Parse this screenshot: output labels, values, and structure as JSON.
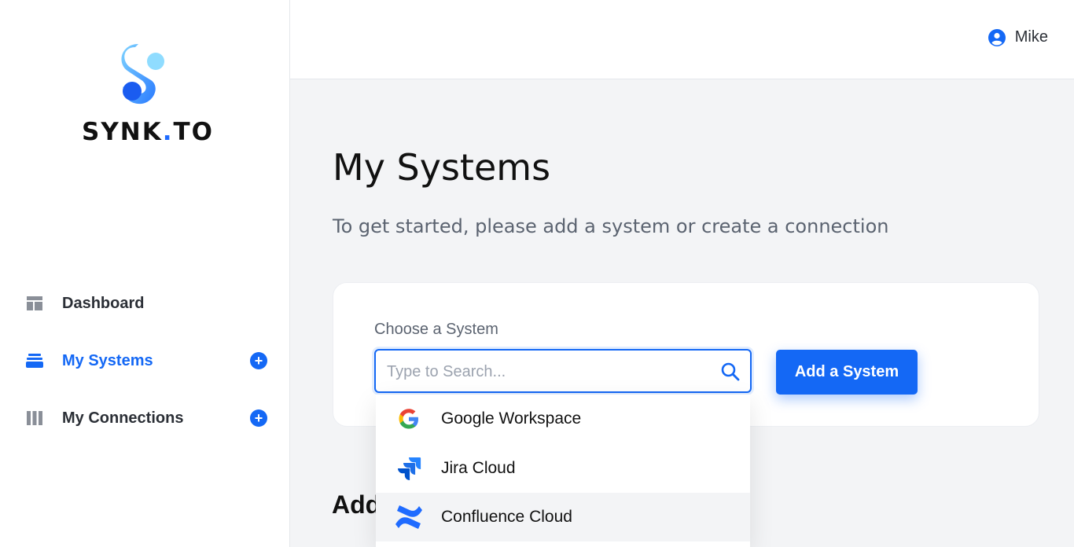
{
  "brand": {
    "name_part1": "SYNK",
    "name_dot": ".",
    "name_part2": "TO"
  },
  "user": {
    "name": "Mike"
  },
  "sidebar": {
    "items": [
      {
        "label": "Dashboard",
        "icon": "dashboard-icon",
        "active": false
      },
      {
        "label": "My Systems",
        "icon": "systems-stack-icon",
        "active": true,
        "add": true
      },
      {
        "label": "My Connections",
        "icon": "connections-columns-icon",
        "active": false,
        "add": true
      }
    ]
  },
  "main": {
    "title": "My Systems",
    "subtitle": "To get started, please add a system or create a connection",
    "choose_label": "Choose a System",
    "search_placeholder": "Type to Search...",
    "add_button": "Add a System",
    "section_heading_partial": "Add"
  },
  "dropdown": {
    "items": [
      {
        "label": "Google Workspace",
        "icon": "google-icon"
      },
      {
        "label": "Jira Cloud",
        "icon": "jira-icon"
      },
      {
        "label": "Confluence Cloud",
        "icon": "confluence-icon",
        "hovered": true
      }
    ]
  },
  "colors": {
    "accent": "#1468f5",
    "text": "#111111",
    "muted": "#5b6370",
    "background": "#f3f4f6"
  }
}
